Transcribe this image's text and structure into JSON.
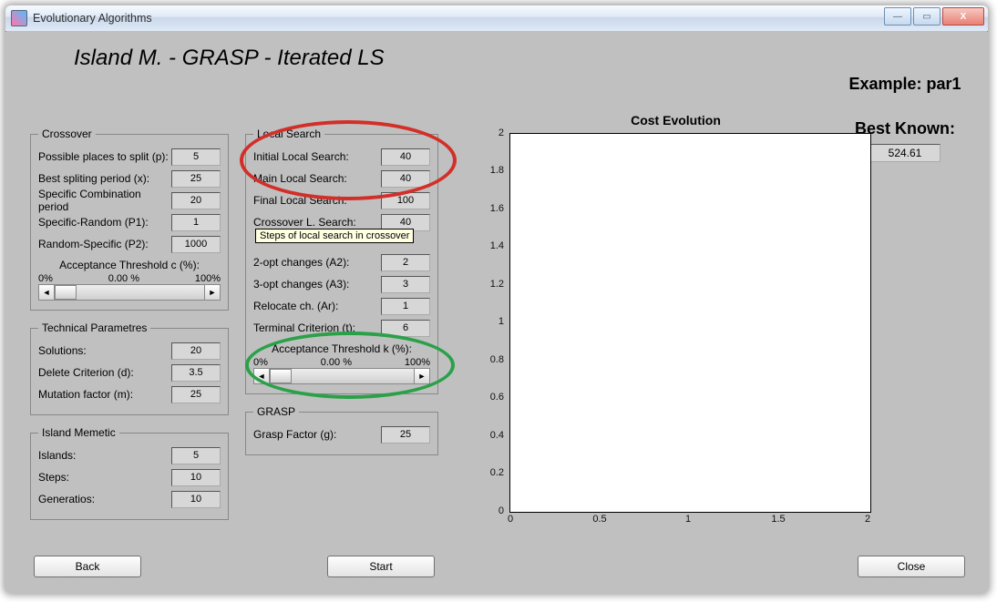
{
  "window": {
    "title": "Evolutionary Algorithms"
  },
  "heading": "Island M. - GRASP - Iterated LS",
  "right": {
    "example_label": "Example: par1",
    "best_label": "Best Known:",
    "best_value": "524.61"
  },
  "crossover": {
    "legend": "Crossover",
    "rows": {
      "p": {
        "label": "Possible places to split (p):",
        "value": "5"
      },
      "x": {
        "label": "Best spliting period (x):",
        "value": "25"
      },
      "sc": {
        "label": "Specific Combination period",
        "value": "20"
      },
      "p1": {
        "label": "Specific-Random (P1):",
        "value": "1"
      },
      "p2": {
        "label": "Random-Specific (P2):",
        "value": "1000"
      }
    },
    "slider": {
      "title": "Acceptance Threshold c (%):",
      "min": "0%",
      "center": "0.00   %",
      "max": "100%"
    }
  },
  "tech": {
    "legend": "Technical Parametres",
    "rows": {
      "solutions": {
        "label": "Solutions:",
        "value": "20"
      },
      "delete": {
        "label": "Delete Criterion (d):",
        "value": "3.5"
      },
      "mutation": {
        "label": "Mutation factor (m):",
        "value": "25"
      }
    }
  },
  "island": {
    "legend": "Island Memetic",
    "rows": {
      "islands": {
        "label": "Islands:",
        "value": "5"
      },
      "steps": {
        "label": "Steps:",
        "value": "10"
      },
      "generations": {
        "label": "Generatios:",
        "value": "10"
      }
    }
  },
  "local": {
    "legend": "Local Search",
    "rows": {
      "initial": {
        "label": "Initial Local Search:",
        "value": "40"
      },
      "main": {
        "label": "Main Local Search:",
        "value": "40"
      },
      "final": {
        "label": "Final Local Search:",
        "value": "100"
      },
      "crossover": {
        "label": "Crossover L. Search:",
        "value": "40"
      },
      "a2": {
        "label": "2-opt changes (A2):",
        "value": "2"
      },
      "a3": {
        "label": "3-opt changes (A3):",
        "value": "3"
      },
      "ar": {
        "label": "Relocate ch. (Ar):",
        "value": "1"
      },
      "terminal": {
        "label": "Terminal Criterion (t):",
        "value": "6"
      }
    },
    "tooltip": "Steps of local search in crossover",
    "slider": {
      "title": "Acceptance Threshold k (%):",
      "min": "0%",
      "center": "0.00   %",
      "max": "100%"
    }
  },
  "grasp": {
    "legend": "GRASP",
    "row": {
      "label": "Grasp Factor (g):",
      "value": "25"
    }
  },
  "chart": {
    "title": "Cost Evolution",
    "y_ticks": [
      "2",
      "1.8",
      "1.6",
      "1.4",
      "1.2",
      "1",
      "0.8",
      "0.6",
      "0.4",
      "0.2",
      "0"
    ],
    "x_ticks": [
      "0",
      "0.5",
      "1",
      "1.5",
      "2"
    ]
  },
  "chart_data": {
    "type": "line",
    "title": "Cost Evolution",
    "xlabel": "",
    "ylabel": "",
    "xlim": [
      0,
      2
    ],
    "ylim": [
      0,
      2
    ],
    "x_ticks": [
      0,
      0.5,
      1,
      1.5,
      2
    ],
    "y_ticks": [
      0,
      0.2,
      0.4,
      0.6,
      0.8,
      1,
      1.2,
      1.4,
      1.6,
      1.8,
      2
    ],
    "series": []
  },
  "buttons": {
    "back": "Back",
    "start": "Start",
    "close": "Close"
  }
}
